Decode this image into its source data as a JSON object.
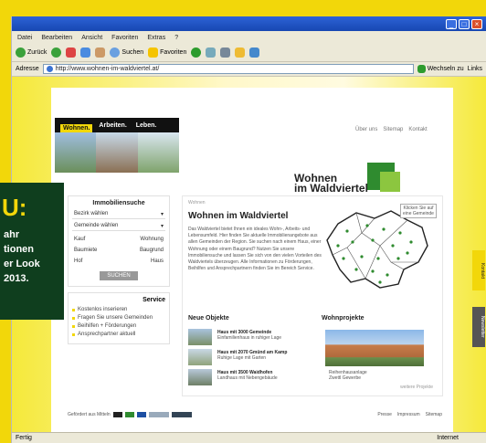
{
  "browser": {
    "menu": [
      "Datei",
      "Bearbeiten",
      "Ansicht",
      "Favoriten",
      "Extras",
      "?"
    ],
    "toolbar": {
      "back_label": "Zurück",
      "search_label": "Suchen",
      "favorites_label": "Favoriten"
    },
    "address": {
      "label": "Adresse",
      "url": "http://www.wohnen-im-waldviertel.at/",
      "go_label": "Wechseln zu",
      "links_label": "Links"
    },
    "status": {
      "left": "Fertig",
      "right": "Internet"
    }
  },
  "page": {
    "hero_tabs": [
      "Wohnen.",
      "Arbeiten.",
      "Leben."
    ],
    "top_links": [
      "Über uns",
      "Sitemap",
      "Kontakt"
    ],
    "logo": {
      "line1": "Wohnen",
      "line2": "im Waldviertel"
    },
    "search": {
      "title": "Immobiliensuche",
      "fields": [
        "Bezirk wählen",
        "Gemeinde wählen"
      ],
      "rows": [
        [
          "Kauf",
          "Wohnung"
        ],
        [
          "Baumiete",
          "Baugrund"
        ],
        [
          "Hof",
          "Haus"
        ]
      ],
      "button": "SUCHEN"
    },
    "service": {
      "title": "Service",
      "items": [
        "Kostenlos inserieren",
        "Fragen Sie unsere Gemeinden",
        "Beihilfen + Förderungen",
        "Ansprechpartner aktuell"
      ]
    },
    "main": {
      "breadcrumb": "Wohnen",
      "heading": "Wohnen im Waldviertel",
      "paragraph": "Das Waldviertel bietet Ihnen ein ideales Wohn-, Arbeits- und Lebensumfeld. Hier finden Sie aktuelle Immobilienangebote aus allen Gemeinden der Region. Sie suchen nach einem Haus, einer Wohnung oder einem Baugrund? Nutzen Sie unsere Immobiliensuche und lassen Sie sich von den vielen Vorteilen des Waldviertels überzeugen. Alle Informationen zu Förderungen, Beihilfen und Ansprechpartnern finden Sie im Bereich Service.",
      "map_note": "Klicken Sie auf eine Gemeinde",
      "neue_objekte_title": "Neue Objekte",
      "objects": [
        {
          "title": "Haus mit 3000 Gemeinde",
          "desc": "Einfamilienhaus in ruhiger Lage"
        },
        {
          "title": "Haus mit 2070 Gmünd am Kamp",
          "desc": "Ruhige Lage mit Garten"
        },
        {
          "title": "Haus mit 3500 Waidhofen",
          "desc": "Landhaus mit Nebengebäude"
        }
      ],
      "wohnprojekte_title": "Wohnprojekte",
      "wohnprojekt": {
        "line1": "Reihenhausanlage",
        "line2": "Zwettl Gewerbe"
      },
      "wohnprojekt_link": "weitere Projekte"
    },
    "footer": {
      "left": "Gefördert aus Mitteln",
      "links": [
        "Presse",
        "Impressum",
        "Sitemap"
      ]
    },
    "side_tabs": [
      "Kontakt",
      "Newsletter"
    ]
  },
  "promo": {
    "headline": "U:",
    "lines": [
      "ahr",
      "tionen",
      "er Look",
      "2013."
    ]
  },
  "colors": {
    "brand_yellow": "#f2d70a",
    "green": "#2f8b2f",
    "xp_blue": "#1747b2"
  }
}
